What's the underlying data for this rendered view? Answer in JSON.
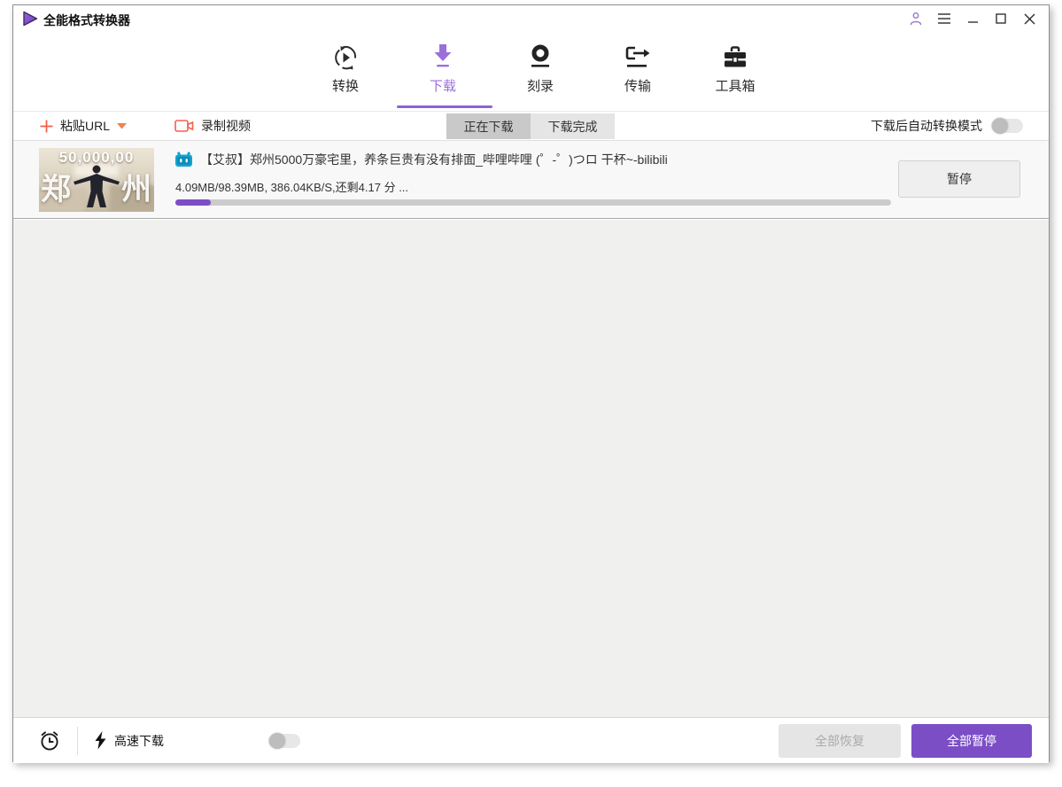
{
  "app": {
    "title": "全能格式转换器"
  },
  "nav": {
    "active_index": 1,
    "tabs": [
      {
        "label": "转换",
        "icon": "convert-icon"
      },
      {
        "label": "下载",
        "icon": "download-icon"
      },
      {
        "label": "刻录",
        "icon": "burn-icon"
      },
      {
        "label": "传输",
        "icon": "transfer-icon"
      },
      {
        "label": "工具箱",
        "icon": "toolbox-icon"
      }
    ]
  },
  "toolbar": {
    "paste_url_label": "粘贴URL",
    "record_video_label": "录制视频",
    "filter_active_index": 0,
    "filter_tabs": [
      {
        "label": "正在下载"
      },
      {
        "label": "下载完成"
      }
    ],
    "auto_convert_label": "下载后自动转换模式",
    "auto_convert_enabled": false
  },
  "download": {
    "item": {
      "source": "bilibili",
      "title": "【艾叔】郑州5000万豪宅里，养条巨贵有没有排面_哔哩哔哩 (゜-゜)つロ 干杯~-bilibili",
      "progress_text": "4.09MB/98.39MB, 386.04KB/S,还剩4.17 分 ...",
      "progress_width": "5%",
      "pause_label": "暂停",
      "thumbnail_overlay": {
        "top": "50,000,00",
        "left": "郑",
        "right": "州"
      }
    }
  },
  "footer": {
    "speed_label": "高速下载",
    "speed_enabled": false,
    "resume_all_label": "全部恢复",
    "pause_all_label": "全部暂停"
  },
  "colors": {
    "accent": "#7b4ec6",
    "accent_light": "#9a6fdc",
    "orange": "#f2624e",
    "bilibili_blue": "#14a5d2"
  }
}
